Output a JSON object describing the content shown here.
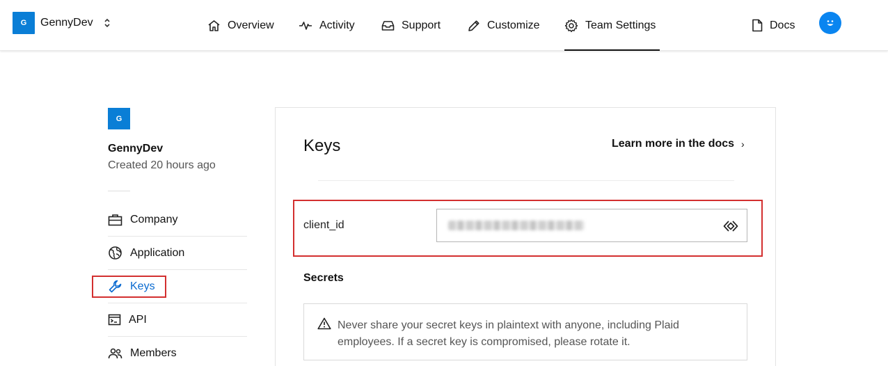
{
  "header": {
    "team_badge": "G",
    "team_name": "GennyDev",
    "nav": [
      {
        "label": "Overview",
        "icon": "home-icon"
      },
      {
        "label": "Activity",
        "icon": "activity-icon"
      },
      {
        "label": "Support",
        "icon": "inbox-icon"
      },
      {
        "label": "Customize",
        "icon": "pencil-icon"
      },
      {
        "label": "Team Settings",
        "icon": "gear-icon",
        "active": true
      }
    ],
    "docs_label": "Docs"
  },
  "sidebar": {
    "team_badge": "G",
    "team_name": "GennyDev",
    "created": "Created 20 hours ago",
    "items": [
      {
        "label": "Company",
        "icon": "briefcase-icon"
      },
      {
        "label": "Application",
        "icon": "globe-icon"
      },
      {
        "label": "Keys",
        "icon": "wrench-icon",
        "active": true
      },
      {
        "label": "API",
        "icon": "terminal-icon"
      },
      {
        "label": "Members",
        "icon": "people-icon"
      }
    ]
  },
  "main": {
    "title": "Keys",
    "learn_more": "Learn more in the docs",
    "client_id_label": "client_id",
    "secrets_heading": "Secrets",
    "warning": "Never share your secret keys in plaintext with anyone, including Plaid employees. If a secret key is compromised, please rotate it."
  },
  "colors": {
    "accent": "#0a7ed6",
    "active_link": "#0a6ad0",
    "highlight": "#d32f2f"
  }
}
